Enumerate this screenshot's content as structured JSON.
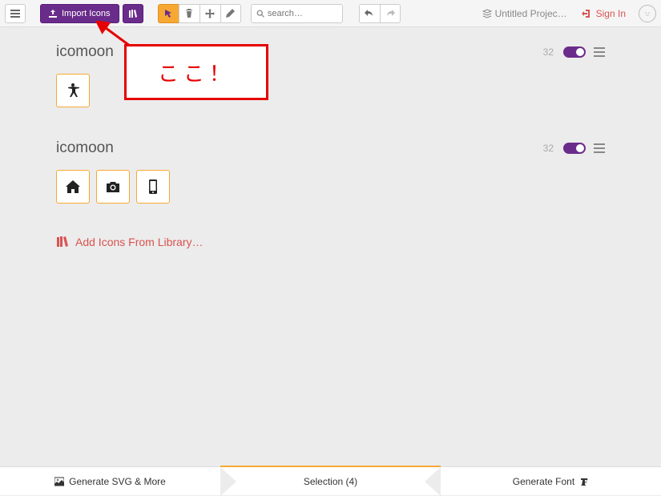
{
  "toolbar": {
    "import_label": "Import Icons",
    "search_placeholder": "search…"
  },
  "header": {
    "project_label": "Untitled Projec…",
    "signin_label": "Sign In"
  },
  "sections": [
    {
      "title": "icomoon",
      "count": 32,
      "icons": [
        "accessibility"
      ]
    },
    {
      "title": "icomoon",
      "count": 32,
      "icons": [
        "home",
        "camera",
        "mobile"
      ]
    }
  ],
  "library_link_label": "Add Icons From Library…",
  "bottom": {
    "svg_label": "Generate SVG & More",
    "selection_label": "Selection (4)",
    "font_label": "Generate Font"
  },
  "annotation_text": "ここ！"
}
